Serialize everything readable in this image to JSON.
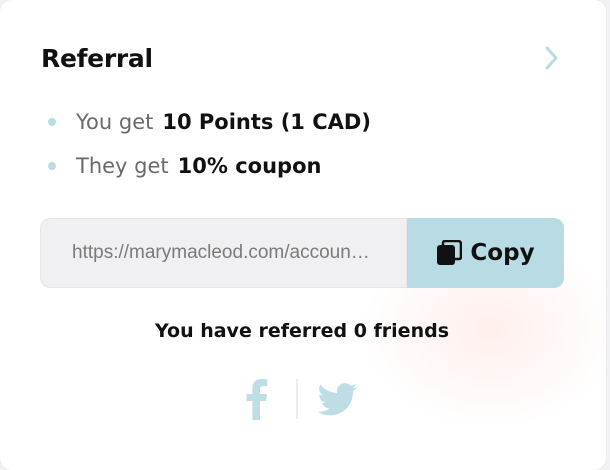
{
  "referral": {
    "title": "Referral",
    "benefits": [
      {
        "label": "You get",
        "value": "10 Points (1 CAD)"
      },
      {
        "label": "They get",
        "value": "10% coupon"
      }
    ],
    "link": {
      "value": "https://marymacleod.com/account?ref=referral"
    },
    "copy_label": "Copy",
    "referred_text": "You have referred 0 friends",
    "share_icons": [
      "facebook-icon",
      "twitter-icon"
    ]
  },
  "colors": {
    "accent": "#b9dbe3",
    "input_bg": "#f0eff1",
    "text": "#111111",
    "muted": "#6a6a6a",
    "social_icon": "#bfdde5"
  }
}
